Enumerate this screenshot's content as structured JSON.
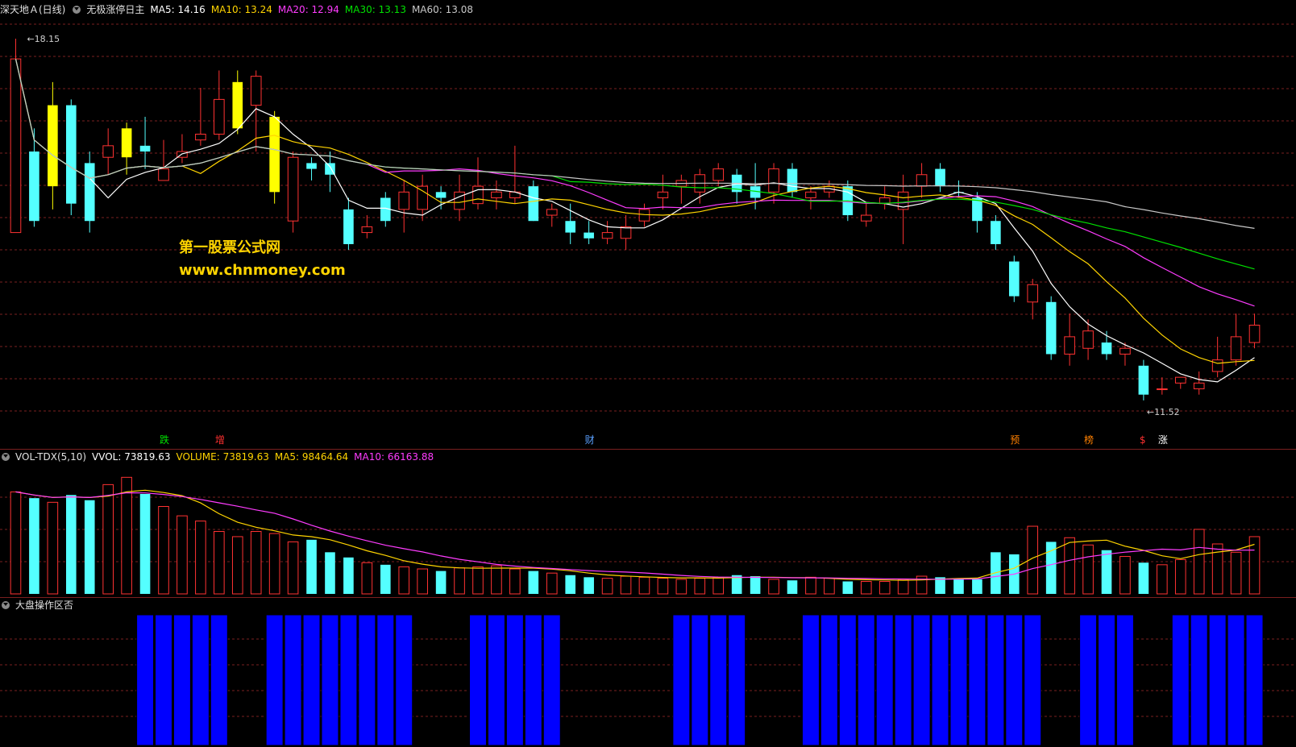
{
  "header": {
    "stock_name": "深天地Ａ(日线)",
    "indicator_name": "无极涨停日主",
    "ma_items": [
      {
        "label": "MA5: 14.16",
        "color": "#ffffff"
      },
      {
        "label": "MA10: 13.24",
        "color": "#ffd400"
      },
      {
        "label": "MA20: 12.94",
        "color": "#ff3cff"
      },
      {
        "label": "MA30: 13.13",
        "color": "#00e000"
      },
      {
        "label": "MA60: 13.08",
        "color": "#c8c8c8"
      }
    ]
  },
  "price_panel": {
    "high_label": "18.15",
    "low_label": "11.52",
    "watermark_title": "第一股票公式网",
    "watermark_url": "www.chnmoney.com",
    "markers": [
      {
        "text": "跌",
        "color": "#00e000"
      },
      {
        "text": "增",
        "color": "#ff3030"
      },
      {
        "text": "财",
        "color": "#5aa0ff"
      },
      {
        "text": "预",
        "color": "#ff8000"
      },
      {
        "text": "榜",
        "color": "#ff8000"
      },
      {
        "text": "$",
        "color": "#ff3030"
      },
      {
        "text": "涨",
        "color": "#ffffff"
      }
    ]
  },
  "volume_panel": {
    "indicator": "VOL-TDX(5,10)",
    "vvol": "VVOL: 73819.63",
    "volume": "VOLUME: 73819.63",
    "ma5": "MA5: 98464.64",
    "ma10": "MA10: 66163.88"
  },
  "market_panel": {
    "title": "大盘操作区否"
  },
  "colors": {
    "up": "#ff3232",
    "down": "#54ffff",
    "limit_up": "#ffff00",
    "bar_blue": "#0000ff",
    "ma5": "#ffffff",
    "ma10": "#ffd400",
    "ma20": "#ff3cff",
    "ma30": "#00e000",
    "ma60": "#c8c8c8",
    "grid": "#7a1f1f"
  },
  "chart_data": {
    "type": "candlestick",
    "y_range": [
      11.3,
      18.4
    ],
    "candles": [
      {
        "o": 14.8,
        "c": 17.8,
        "h": 18.15,
        "l": 15.6,
        "k": "u"
      },
      {
        "o": 16.2,
        "c": 15.0,
        "h": 16.6,
        "l": 14.9,
        "k": "d"
      },
      {
        "o": 17.0,
        "c": 15.6,
        "h": 17.4,
        "l": 15.2,
        "k": "y"
      },
      {
        "o": 17.0,
        "c": 15.3,
        "h": 17.1,
        "l": 15.1,
        "k": "d"
      },
      {
        "o": 16.0,
        "c": 15.0,
        "h": 16.2,
        "l": 14.8,
        "k": "d"
      },
      {
        "o": 16.3,
        "c": 16.1,
        "h": 16.6,
        "l": 15.8,
        "k": "u"
      },
      {
        "o": 16.1,
        "c": 16.6,
        "h": 16.7,
        "l": 15.8,
        "k": "y"
      },
      {
        "o": 16.3,
        "c": 16.2,
        "h": 16.8,
        "l": 15.9,
        "k": "d"
      },
      {
        "o": 15.9,
        "c": 15.7,
        "h": 16.4,
        "l": 15.7,
        "k": "u"
      },
      {
        "o": 16.1,
        "c": 16.2,
        "h": 16.5,
        "l": 16.0,
        "k": "u"
      },
      {
        "o": 16.4,
        "c": 16.5,
        "h": 17.3,
        "l": 16.3,
        "k": "u"
      },
      {
        "o": 16.5,
        "c": 17.1,
        "h": 17.6,
        "l": 16.4,
        "k": "u"
      },
      {
        "o": 16.6,
        "c": 17.4,
        "h": 17.6,
        "l": 16.5,
        "k": "y"
      },
      {
        "o": 17.0,
        "c": 17.5,
        "h": 17.6,
        "l": 16.2,
        "k": "u"
      },
      {
        "o": 16.8,
        "c": 15.5,
        "h": 16.9,
        "l": 15.3,
        "k": "y"
      },
      {
        "o": 16.1,
        "c": 15.0,
        "h": 16.2,
        "l": 14.8,
        "k": "u"
      },
      {
        "o": 16.0,
        "c": 15.9,
        "h": 16.1,
        "l": 15.7,
        "k": "d"
      },
      {
        "o": 16.0,
        "c": 15.8,
        "h": 16.2,
        "l": 15.5,
        "k": "d"
      },
      {
        "o": 15.2,
        "c": 14.6,
        "h": 15.4,
        "l": 14.5,
        "k": "d"
      },
      {
        "o": 14.9,
        "c": 14.8,
        "h": 15.1,
        "l": 14.7,
        "k": "u"
      },
      {
        "o": 15.4,
        "c": 15.0,
        "h": 15.5,
        "l": 14.9,
        "k": "d"
      },
      {
        "o": 15.2,
        "c": 15.5,
        "h": 15.7,
        "l": 14.8,
        "k": "u"
      },
      {
        "o": 15.2,
        "c": 15.6,
        "h": 15.8,
        "l": 15.0,
        "k": "u"
      },
      {
        "o": 15.4,
        "c": 15.5,
        "h": 15.6,
        "l": 15.2,
        "k": "d"
      },
      {
        "o": 15.2,
        "c": 15.5,
        "h": 15.8,
        "l": 15.0,
        "k": "u"
      },
      {
        "o": 15.3,
        "c": 15.6,
        "h": 16.1,
        "l": 15.2,
        "k": "u"
      },
      {
        "o": 15.4,
        "c": 15.5,
        "h": 15.7,
        "l": 15.2,
        "k": "u"
      },
      {
        "o": 15.5,
        "c": 15.4,
        "h": 16.3,
        "l": 15.3,
        "k": "u"
      },
      {
        "o": 15.6,
        "c": 15.0,
        "h": 15.7,
        "l": 15.0,
        "k": "d"
      },
      {
        "o": 15.1,
        "c": 15.2,
        "h": 15.3,
        "l": 14.9,
        "k": "u"
      },
      {
        "o": 15.0,
        "c": 14.8,
        "h": 15.3,
        "l": 14.6,
        "k": "d"
      },
      {
        "o": 14.8,
        "c": 14.7,
        "h": 15.0,
        "l": 14.6,
        "k": "d"
      },
      {
        "o": 14.7,
        "c": 14.8,
        "h": 15.0,
        "l": 14.6,
        "k": "u"
      },
      {
        "o": 14.7,
        "c": 14.9,
        "h": 15.1,
        "l": 14.5,
        "k": "u"
      },
      {
        "o": 15.0,
        "c": 15.2,
        "h": 15.3,
        "l": 14.9,
        "k": "u"
      },
      {
        "o": 15.4,
        "c": 15.5,
        "h": 15.8,
        "l": 15.2,
        "k": "u"
      },
      {
        "o": 15.6,
        "c": 15.7,
        "h": 15.8,
        "l": 15.3,
        "k": "u"
      },
      {
        "o": 15.5,
        "c": 15.8,
        "h": 15.9,
        "l": 15.3,
        "k": "u"
      },
      {
        "o": 15.9,
        "c": 15.7,
        "h": 16.0,
        "l": 15.6,
        "k": "u"
      },
      {
        "o": 15.8,
        "c": 15.5,
        "h": 15.9,
        "l": 15.3,
        "k": "d"
      },
      {
        "o": 15.6,
        "c": 15.4,
        "h": 16.0,
        "l": 15.2,
        "k": "d"
      },
      {
        "o": 15.5,
        "c": 15.9,
        "h": 16.0,
        "l": 15.3,
        "k": "u"
      },
      {
        "o": 15.9,
        "c": 15.5,
        "h": 16.0,
        "l": 15.4,
        "k": "d"
      },
      {
        "o": 15.4,
        "c": 15.5,
        "h": 15.6,
        "l": 15.2,
        "k": "u"
      },
      {
        "o": 15.6,
        "c": 15.5,
        "h": 15.7,
        "l": 15.4,
        "k": "u"
      },
      {
        "o": 15.6,
        "c": 15.1,
        "h": 15.7,
        "l": 15.0,
        "k": "d"
      },
      {
        "o": 15.1,
        "c": 15.0,
        "h": 15.3,
        "l": 14.9,
        "k": "u"
      },
      {
        "o": 15.3,
        "c": 15.4,
        "h": 15.6,
        "l": 15.2,
        "k": "u"
      },
      {
        "o": 15.5,
        "c": 15.2,
        "h": 15.8,
        "l": 14.6,
        "k": "u"
      },
      {
        "o": 15.6,
        "c": 15.8,
        "h": 16.0,
        "l": 15.4,
        "k": "u"
      },
      {
        "o": 15.9,
        "c": 15.6,
        "h": 16.0,
        "l": 15.5,
        "k": "d"
      },
      {
        "o": 15.5,
        "c": 15.5,
        "h": 15.7,
        "l": 15.4,
        "k": "d"
      },
      {
        "o": 15.4,
        "c": 15.0,
        "h": 15.5,
        "l": 14.8,
        "k": "d"
      },
      {
        "o": 15.0,
        "c": 14.6,
        "h": 15.1,
        "l": 14.5,
        "k": "d"
      },
      {
        "o": 14.3,
        "c": 13.7,
        "h": 14.4,
        "l": 13.6,
        "k": "d"
      },
      {
        "o": 13.9,
        "c": 13.6,
        "h": 14.0,
        "l": 13.3,
        "k": "u"
      },
      {
        "o": 13.6,
        "c": 12.7,
        "h": 13.7,
        "l": 12.6,
        "k": "d"
      },
      {
        "o": 12.7,
        "c": 13.0,
        "h": 13.4,
        "l": 12.5,
        "k": "u"
      },
      {
        "o": 12.8,
        "c": 13.1,
        "h": 13.3,
        "l": 12.6,
        "k": "u"
      },
      {
        "o": 12.9,
        "c": 12.7,
        "h": 13.1,
        "l": 12.6,
        "k": "d"
      },
      {
        "o": 12.7,
        "c": 12.8,
        "h": 12.9,
        "l": 12.5,
        "k": "u"
      },
      {
        "o": 12.5,
        "c": 12.0,
        "h": 12.6,
        "l": 11.9,
        "k": "d"
      },
      {
        "o": 12.1,
        "c": 12.1,
        "h": 12.3,
        "l": 12.0,
        "k": "u"
      },
      {
        "o": 12.3,
        "c": 12.2,
        "h": 12.3,
        "l": 12.1,
        "k": "u"
      },
      {
        "o": 12.1,
        "c": 12.2,
        "h": 12.4,
        "l": 12.0,
        "k": "u"
      },
      {
        "o": 12.4,
        "c": 12.6,
        "h": 13.0,
        "l": 12.3,
        "k": "u"
      },
      {
        "o": 12.6,
        "c": 13.0,
        "h": 13.4,
        "l": 12.5,
        "k": "u"
      },
      {
        "o": 12.9,
        "c": 13.2,
        "h": 13.4,
        "l": 12.8,
        "k": "u"
      }
    ],
    "volume_series": [
      98,
      92,
      88,
      95,
      90,
      105,
      112,
      96,
      84,
      75,
      70,
      60,
      55,
      60,
      58,
      50,
      52,
      40,
      35,
      30,
      28,
      26,
      24,
      22,
      25,
      26,
      27,
      24,
      22,
      20,
      18,
      16,
      15,
      17,
      16,
      15,
      14,
      15,
      16,
      18,
      17,
      14,
      13,
      16,
      15,
      12,
      12,
      12,
      14,
      17,
      16,
      15,
      14,
      40,
      38,
      65,
      50,
      54,
      47,
      42,
      36,
      30,
      28,
      33,
      62,
      48,
      40,
      55
    ],
    "market_on": [
      0,
      0,
      0,
      0,
      0,
      0,
      0,
      1,
      1,
      1,
      1,
      1,
      0,
      0,
      1,
      1,
      1,
      1,
      1,
      1,
      1,
      1,
      0,
      0,
      0,
      1,
      1,
      1,
      1,
      1,
      0,
      0,
      0,
      0,
      0,
      0,
      1,
      1,
      1,
      1,
      0,
      0,
      0,
      1,
      1,
      1,
      1,
      1,
      1,
      1,
      1,
      1,
      1,
      1,
      1,
      1,
      0,
      0,
      1,
      1,
      1,
      0,
      0,
      1,
      1,
      1,
      1,
      1
    ]
  }
}
